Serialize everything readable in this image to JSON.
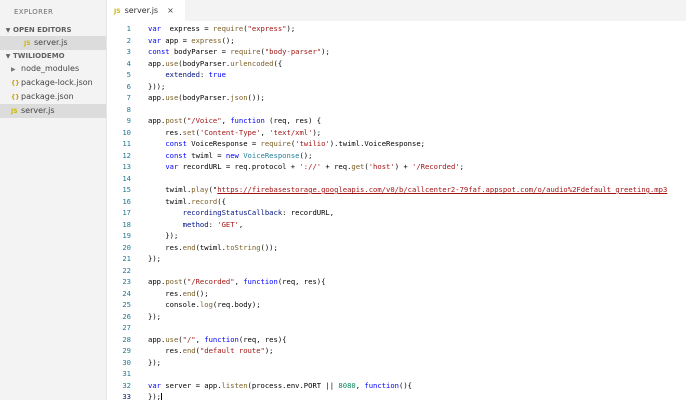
{
  "sidebar": {
    "title": "EXPLORER",
    "open_editors": {
      "header": "OPEN EDITORS",
      "items": [
        {
          "icon": "JS",
          "label": "server.js"
        }
      ]
    },
    "project": {
      "header": "TWILIODEMO",
      "items": [
        {
          "icon": "chevron-right",
          "label": "node_modules"
        },
        {
          "icon": "{}",
          "label": "package-lock.json"
        },
        {
          "icon": "{}",
          "label": "package.json"
        },
        {
          "icon": "JS",
          "label": "server.js"
        }
      ]
    }
  },
  "tab": {
    "icon": "JS",
    "label": "server.js",
    "close": "×"
  },
  "editor": {
    "language": "javascript",
    "active_line": 33,
    "lines": [
      {
        "n": "1",
        "tokens": [
          [
            "k",
            "var"
          ],
          [
            "",
            "  express = "
          ],
          [
            "f",
            "require"
          ],
          [
            "",
            "("
          ],
          [
            "s",
            "\"express\""
          ],
          [
            "",
            ");"
          ]
        ]
      },
      {
        "n": "2",
        "tokens": [
          [
            "k",
            "var"
          ],
          [
            "",
            " app = "
          ],
          [
            "f",
            "express"
          ],
          [
            "",
            "();"
          ]
        ]
      },
      {
        "n": "3",
        "tokens": [
          [
            "k",
            "const"
          ],
          [
            "",
            " bodyParser = "
          ],
          [
            "f",
            "require"
          ],
          [
            "",
            "("
          ],
          [
            "s",
            "\"body-parser\""
          ],
          [
            "",
            ");"
          ]
        ]
      },
      {
        "n": "4",
        "tokens": [
          [
            "",
            "app."
          ],
          [
            "f",
            "use"
          ],
          [
            "",
            "(bodyParser."
          ],
          [
            "f",
            "urlencoded"
          ],
          [
            "",
            "({"
          ]
        ]
      },
      {
        "n": "5",
        "tokens": [
          [
            "",
            "    "
          ],
          [
            "p",
            "extended"
          ],
          [
            "",
            ": "
          ],
          [
            "k",
            "true"
          ]
        ]
      },
      {
        "n": "6",
        "tokens": [
          [
            "",
            "}));"
          ]
        ]
      },
      {
        "n": "7",
        "tokens": [
          [
            "",
            "app."
          ],
          [
            "f",
            "use"
          ],
          [
            "",
            "(bodyParser."
          ],
          [
            "f",
            "json"
          ],
          [
            "",
            "());"
          ]
        ]
      },
      {
        "n": "8",
        "tokens": []
      },
      {
        "n": "9",
        "tokens": [
          [
            "",
            "app."
          ],
          [
            "f",
            "post"
          ],
          [
            "",
            "("
          ],
          [
            "s",
            "\"/Voice\""
          ],
          [
            "",
            ", "
          ],
          [
            "k",
            "function"
          ],
          [
            "",
            " (req, res) {"
          ]
        ]
      },
      {
        "n": "10",
        "tokens": [
          [
            "",
            "    res."
          ],
          [
            "f",
            "set"
          ],
          [
            "",
            "("
          ],
          [
            "s",
            "'Content-Type'"
          ],
          [
            "",
            ", "
          ],
          [
            "s",
            "'text/xml'"
          ],
          [
            "",
            ");"
          ]
        ]
      },
      {
        "n": "11",
        "tokens": [
          [
            "",
            "    "
          ],
          [
            "k",
            "const"
          ],
          [
            "",
            " VoiceResponse = "
          ],
          [
            "f",
            "require"
          ],
          [
            "",
            "("
          ],
          [
            "s",
            "'twilio'"
          ],
          [
            "",
            ").twiml.VoiceResponse;"
          ]
        ]
      },
      {
        "n": "12",
        "tokens": [
          [
            "",
            "    "
          ],
          [
            "k",
            "const"
          ],
          [
            "",
            " twiml = "
          ],
          [
            "k",
            "new"
          ],
          [
            "",
            " "
          ],
          [
            "t",
            "VoiceResponse"
          ],
          [
            "",
            "();"
          ]
        ]
      },
      {
        "n": "13",
        "tokens": [
          [
            "",
            "    "
          ],
          [
            "k",
            "var"
          ],
          [
            "",
            " recordURL = req.protocol + "
          ],
          [
            "s",
            "'://'"
          ],
          [
            "",
            " + req."
          ],
          [
            "f",
            "get"
          ],
          [
            "",
            "("
          ],
          [
            "s",
            "'host'"
          ],
          [
            "",
            ") + "
          ],
          [
            "s",
            "'/Recorded'"
          ],
          [
            "",
            ";"
          ]
        ]
      },
      {
        "n": "14",
        "tokens": []
      },
      {
        "n": "15",
        "tokens": [
          [
            "",
            "    twiml."
          ],
          [
            "f",
            "play"
          ],
          [
            "",
            "(\""
          ],
          [
            "u",
            "https://firebasestorage.googleapis.com/v0/b/callcenter2-79faf.appspot.com/o/audio%2Fdefault_greeting.mp3"
          ]
        ]
      },
      {
        "n": "16",
        "tokens": [
          [
            "",
            "    twiml."
          ],
          [
            "f",
            "record"
          ],
          [
            "",
            "({"
          ]
        ]
      },
      {
        "n": "17",
        "tokens": [
          [
            "",
            "        "
          ],
          [
            "p",
            "recordingStatusCallback"
          ],
          [
            "",
            ": recordURL,"
          ]
        ]
      },
      {
        "n": "18",
        "tokens": [
          [
            "",
            "        "
          ],
          [
            "p",
            "method"
          ],
          [
            "",
            ": "
          ],
          [
            "s",
            "'GET'"
          ],
          [
            "",
            ","
          ]
        ]
      },
      {
        "n": "19",
        "tokens": [
          [
            "",
            "    });"
          ]
        ]
      },
      {
        "n": "20",
        "tokens": [
          [
            "",
            "    res."
          ],
          [
            "f",
            "end"
          ],
          [
            "",
            "(twiml."
          ],
          [
            "f",
            "toString"
          ],
          [
            "",
            "());"
          ]
        ]
      },
      {
        "n": "21",
        "tokens": [
          [
            "",
            "});"
          ]
        ]
      },
      {
        "n": "22",
        "tokens": []
      },
      {
        "n": "23",
        "tokens": [
          [
            "",
            "app."
          ],
          [
            "f",
            "post"
          ],
          [
            "",
            "("
          ],
          [
            "s",
            "\"/Recorded\""
          ],
          [
            "",
            ", "
          ],
          [
            "k",
            "function"
          ],
          [
            "",
            "(req, res){"
          ]
        ]
      },
      {
        "n": "24",
        "tokens": [
          [
            "",
            "    res."
          ],
          [
            "f",
            "end"
          ],
          [
            "",
            "();"
          ]
        ]
      },
      {
        "n": "25",
        "tokens": [
          [
            "",
            "    console."
          ],
          [
            "f",
            "log"
          ],
          [
            "",
            "(req.body);"
          ]
        ]
      },
      {
        "n": "26",
        "tokens": [
          [
            "",
            "});"
          ]
        ]
      },
      {
        "n": "27",
        "tokens": []
      },
      {
        "n": "28",
        "tokens": [
          [
            "",
            "app."
          ],
          [
            "f",
            "use"
          ],
          [
            "",
            "("
          ],
          [
            "s",
            "\"/\""
          ],
          [
            "",
            ", "
          ],
          [
            "k",
            "function"
          ],
          [
            "",
            "(req, res){"
          ]
        ]
      },
      {
        "n": "29",
        "tokens": [
          [
            "",
            "    res."
          ],
          [
            "f",
            "end"
          ],
          [
            "",
            "("
          ],
          [
            "s",
            "\"default route\""
          ],
          [
            "",
            ");"
          ]
        ]
      },
      {
        "n": "30",
        "tokens": [
          [
            "",
            "});"
          ]
        ]
      },
      {
        "n": "31",
        "tokens": []
      },
      {
        "n": "32",
        "tokens": [
          [
            "k",
            "var"
          ],
          [
            "",
            " server = app."
          ],
          [
            "f",
            "listen"
          ],
          [
            "",
            "(process.env.PORT || "
          ],
          [
            "n",
            "8080"
          ],
          [
            "",
            ", "
          ],
          [
            "k",
            "function"
          ],
          [
            "",
            "(){"
          ]
        ]
      },
      {
        "n": "33",
        "tokens": [
          [
            "",
            "});"
          ]
        ]
      }
    ]
  }
}
